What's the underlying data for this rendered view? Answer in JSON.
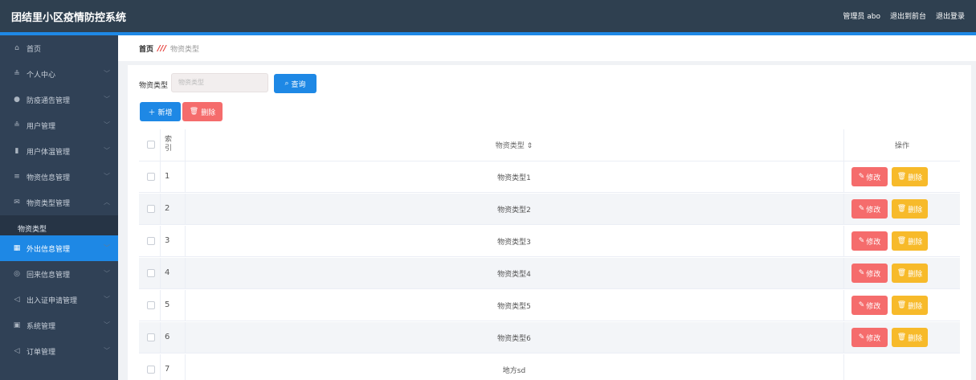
{
  "app": {
    "title": "团结里小区疫情防控系统"
  },
  "topbar": {
    "admin_label": "管理员 abo",
    "to_front": "退出到前台",
    "logout": "退出登录"
  },
  "sidebar": {
    "items": [
      {
        "label": "首页",
        "icon": "home-icon"
      },
      {
        "label": "个人中心",
        "icon": "user-icon"
      },
      {
        "label": "防疫通告管理",
        "icon": "location-icon"
      },
      {
        "label": "用户管理",
        "icon": "user-icon"
      },
      {
        "label": "用户体温管理",
        "icon": "thermometer-icon"
      },
      {
        "label": "物资信息管理",
        "icon": "list-icon"
      },
      {
        "label": "物资类型管理",
        "icon": "mail-icon"
      },
      {
        "label": "物资类型",
        "icon": ""
      },
      {
        "label": "外出信息管理",
        "icon": "grid-icon"
      },
      {
        "label": "回来信息管理",
        "icon": "circle-icon"
      },
      {
        "label": "出入证申请管理",
        "icon": "send-icon"
      },
      {
        "label": "系统管理",
        "icon": "settings-icon"
      },
      {
        "label": "订单管理",
        "icon": "send-icon"
      }
    ]
  },
  "breadcrumb": {
    "home": "首页",
    "separator": "///",
    "current": "物资类型"
  },
  "search": {
    "label": "物资类型",
    "placeholder": "物资类型",
    "button": "查询"
  },
  "toolbar": {
    "add": "新增",
    "delete": "删除"
  },
  "table": {
    "headers": {
      "index": "索引",
      "type": "物资类型 ⇕",
      "ops": "操作"
    },
    "rows": [
      {
        "index": "1",
        "type": "物资类型1"
      },
      {
        "index": "2",
        "type": "物资类型2"
      },
      {
        "index": "3",
        "type": "物资类型3"
      },
      {
        "index": "4",
        "type": "物资类型4"
      },
      {
        "index": "5",
        "type": "物资类型5"
      },
      {
        "index": "6",
        "type": "物资类型6"
      },
      {
        "index": "7",
        "type": "地方sd"
      }
    ],
    "edit_label": "修改",
    "delete_label": "删除"
  },
  "colors": {
    "topbar": "#2f4050",
    "sidebar": "#304156",
    "primary": "#1e88e5",
    "danger": "#f56c6c",
    "warning": "#f7ba2a"
  }
}
